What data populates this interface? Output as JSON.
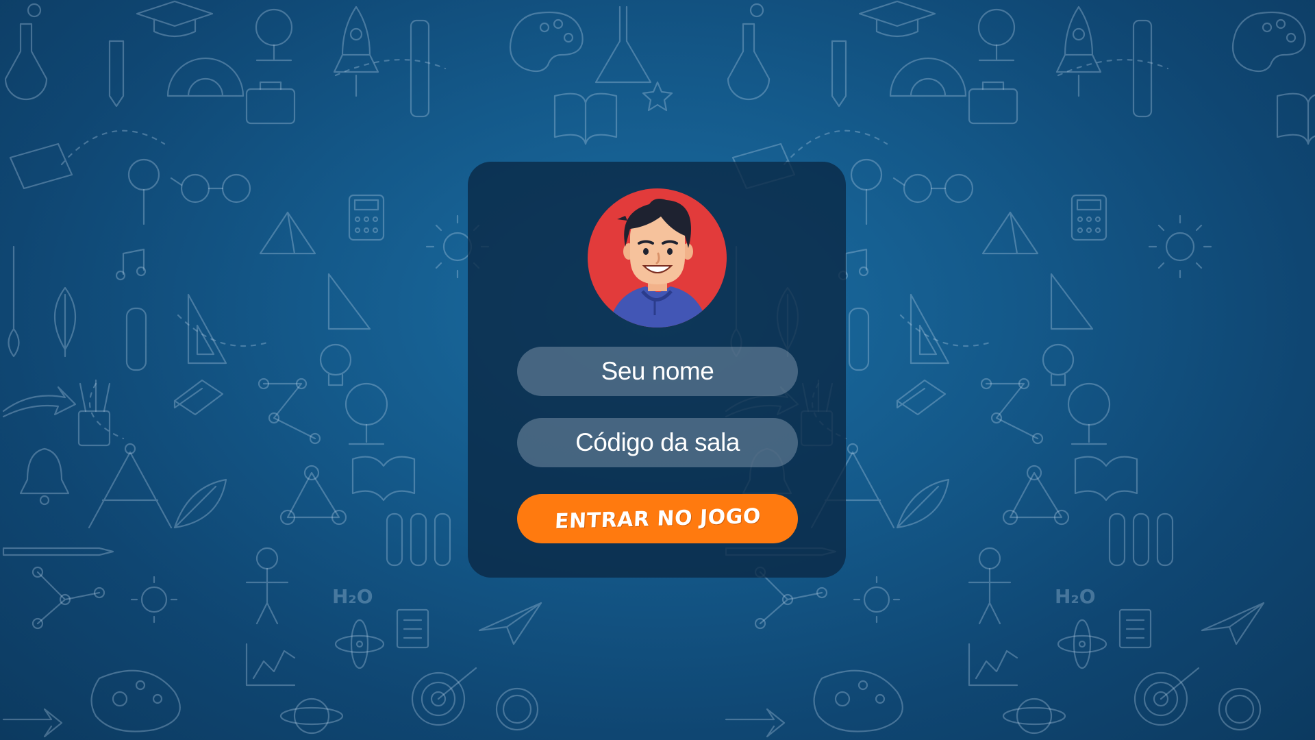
{
  "screen": {
    "background_color": "#14598a"
  },
  "login": {
    "avatar_icon": "student-avatar",
    "name_placeholder": "Seu nome",
    "room_placeholder": "Código da sala",
    "enter_label": "ENTRAR NO JOGO",
    "accent_color": "#ff7a0f",
    "avatar_bg_color": "#e23b3b"
  }
}
